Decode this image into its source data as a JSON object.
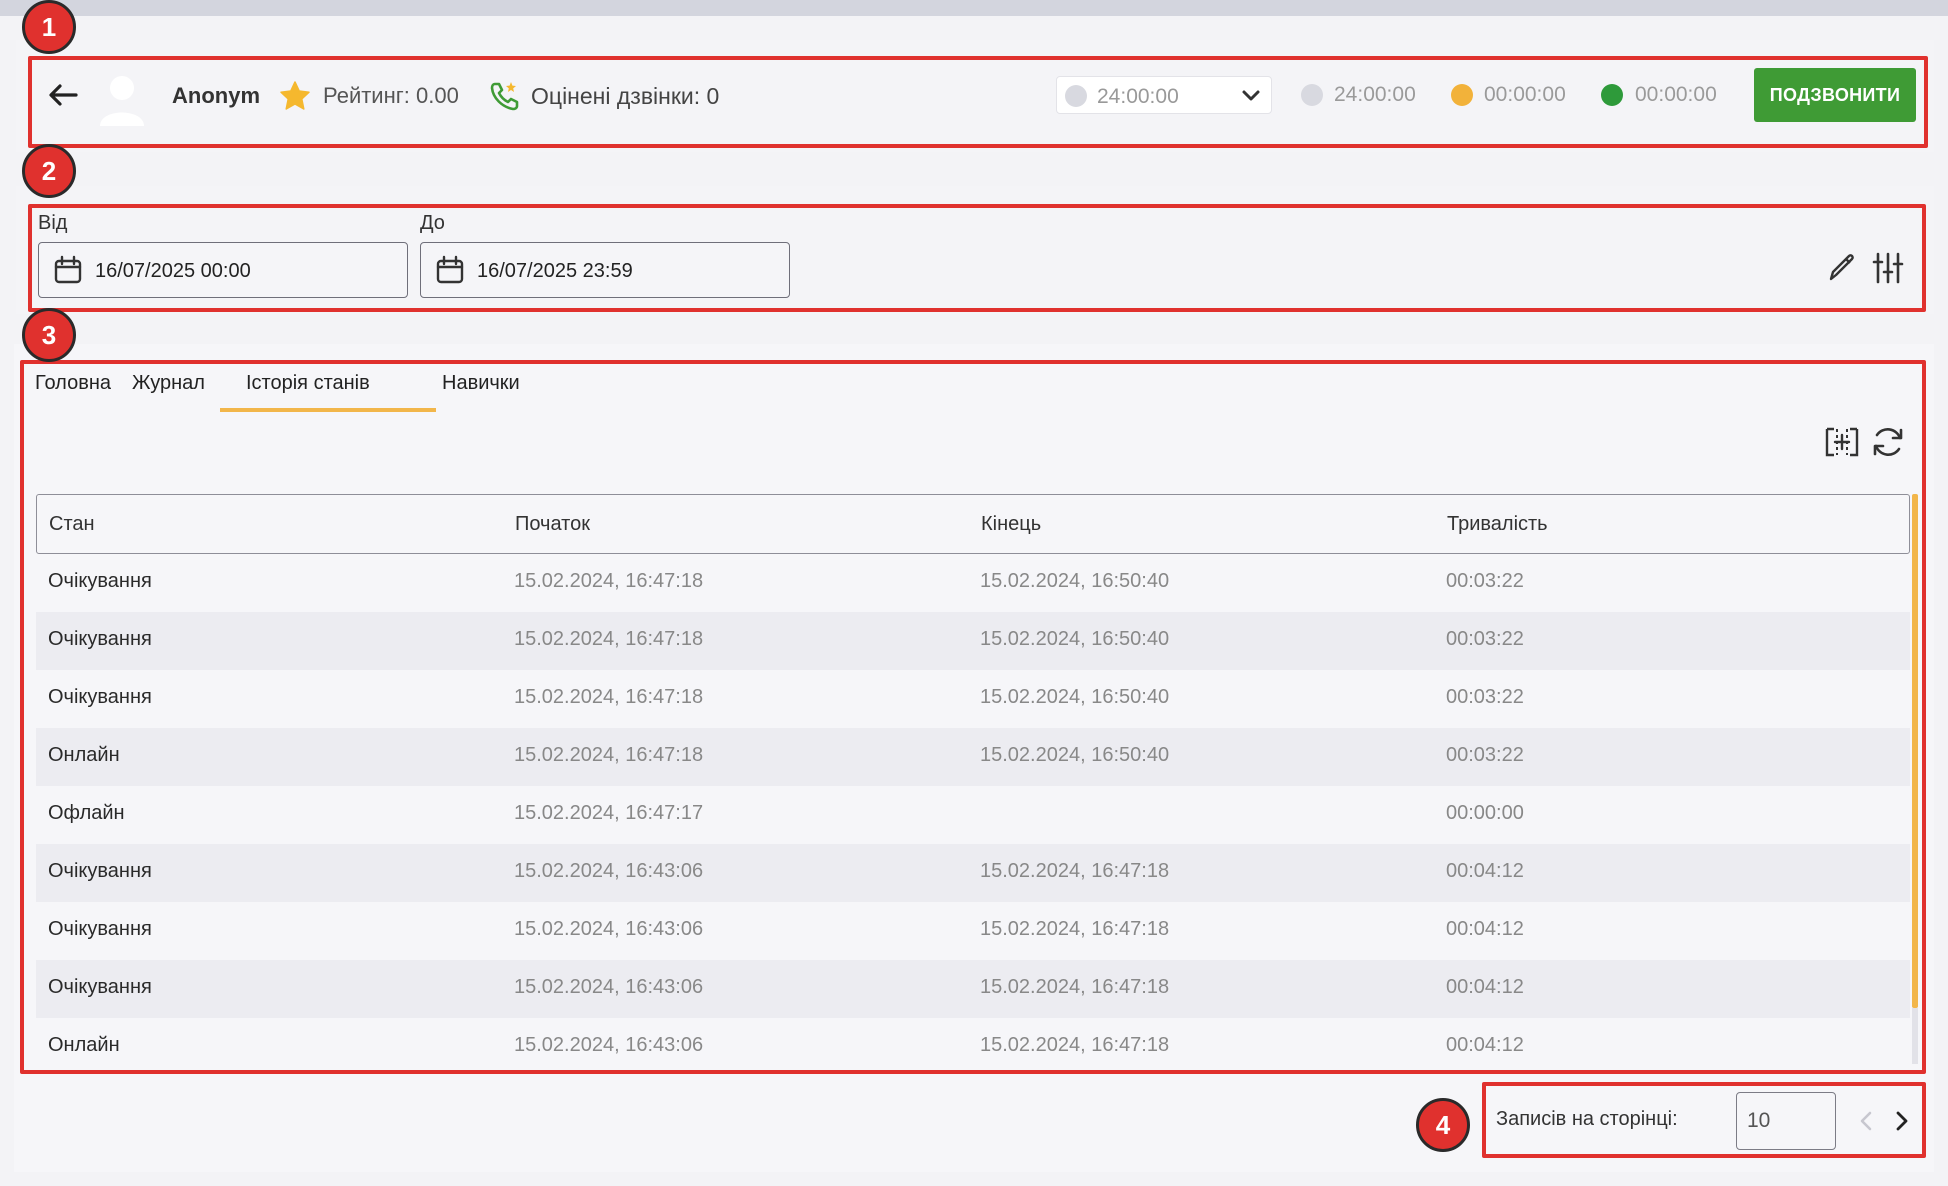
{
  "header": {
    "agent_name": "Anonym",
    "rating_text": "Рейтинг: 0.00",
    "rated_calls_text": "Оцінені дзвінки: 0",
    "status_select_value": "24:00:00",
    "timers": [
      {
        "value": "24:00:00",
        "color": "#d8d9e0"
      },
      {
        "value": "00:00:00",
        "color": "#f2b23a"
      },
      {
        "value": "00:00:00",
        "color": "#2e9a3a"
      }
    ],
    "call_button_label": "ПОДЗВОНИТИ",
    "call_button_color": "#3f9b35"
  },
  "filter": {
    "from_label": "Від",
    "from_value": "16/07/2025 00:00",
    "to_label": "До",
    "to_value": "16/07/2025 23:59"
  },
  "tabs": [
    {
      "label": "Головна"
    },
    {
      "label": "Журнал"
    },
    {
      "label": "Історія станів",
      "active": true
    },
    {
      "label": "Навички"
    }
  ],
  "table": {
    "columns": [
      "Стан",
      "Початок",
      "Кінець",
      "Тривалість"
    ],
    "rows": [
      [
        "Очікування",
        "15.02.2024, 16:47:18",
        "15.02.2024, 16:50:40",
        "00:03:22"
      ],
      [
        "Очікування",
        "15.02.2024, 16:47:18",
        "15.02.2024, 16:50:40",
        "00:03:22"
      ],
      [
        "Очікування",
        "15.02.2024, 16:47:18",
        "15.02.2024, 16:50:40",
        "00:03:22"
      ],
      [
        "Онлайн",
        "15.02.2024, 16:47:18",
        "15.02.2024, 16:50:40",
        "00:03:22"
      ],
      [
        "Офлайн",
        "15.02.2024, 16:47:17",
        "",
        "00:00:00"
      ],
      [
        "Очікування",
        "15.02.2024, 16:43:06",
        "15.02.2024, 16:47:18",
        "00:04:12"
      ],
      [
        "Очікування",
        "15.02.2024, 16:43:06",
        "15.02.2024, 16:47:18",
        "00:04:12"
      ],
      [
        "Очікування",
        "15.02.2024, 16:43:06",
        "15.02.2024, 16:47:18",
        "00:04:12"
      ],
      [
        "Онлайн",
        "15.02.2024, 16:43:06",
        "15.02.2024, 16:47:18",
        "00:04:12"
      ]
    ]
  },
  "pagination": {
    "per_page_label": "Записів на сторінці:",
    "per_page_value": "10"
  },
  "annotations": [
    "1",
    "2",
    "3",
    "4"
  ],
  "colors": {
    "accent": "#f2b64a",
    "annotation_red": "#e0312e"
  },
  "icons": [
    "arrow-left-icon",
    "user-avatar-icon",
    "star-icon",
    "phone-icon",
    "chevron-down-icon",
    "calendar-icon",
    "pencil-icon",
    "sliders-icon",
    "fit-columns-icon",
    "refresh-icon",
    "chevron-left-icon",
    "chevron-right-icon"
  ]
}
